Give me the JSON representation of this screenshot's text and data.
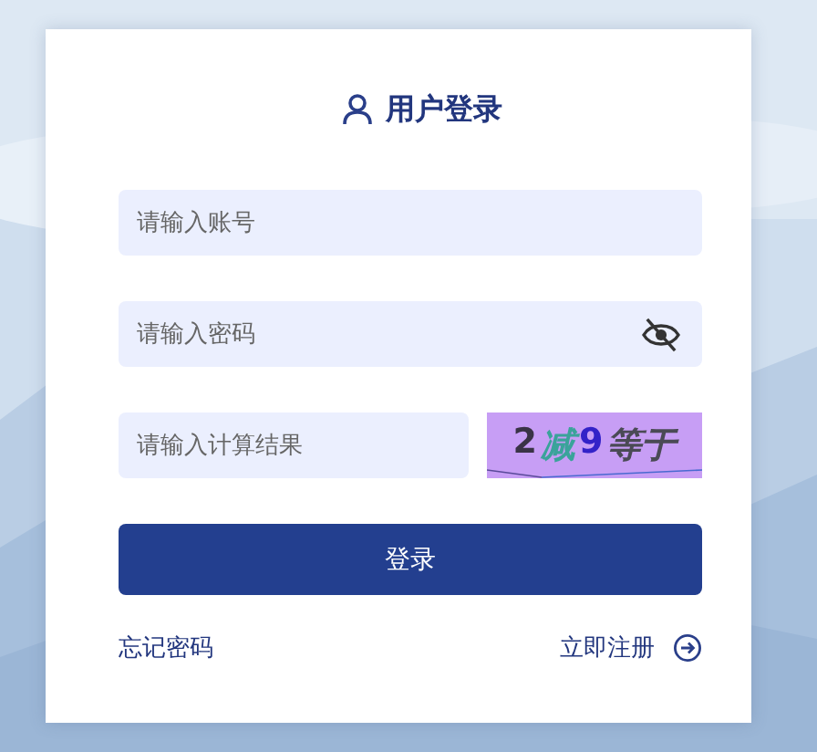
{
  "title": "用户登录",
  "fields": [
    {
      "kind": "text",
      "placeholder": "请输入账号"
    },
    {
      "kind": "password",
      "placeholder": "请输入密码",
      "password_hidden": true
    }
  ],
  "captcha": {
    "placeholder": "请输入计算结果",
    "chars": [
      {
        "text": "2",
        "color": "#3a3346"
      },
      {
        "text": "减",
        "color": "#3aa39a"
      },
      {
        "text": "9",
        "color": "#3322c8"
      },
      {
        "text": "等于",
        "color": "#4a4a55"
      }
    ]
  },
  "login_button": "登录",
  "links": [
    {
      "kind": "forgot",
      "label": "忘记密码"
    },
    {
      "kind": "register",
      "label": "立即注册"
    }
  ]
}
